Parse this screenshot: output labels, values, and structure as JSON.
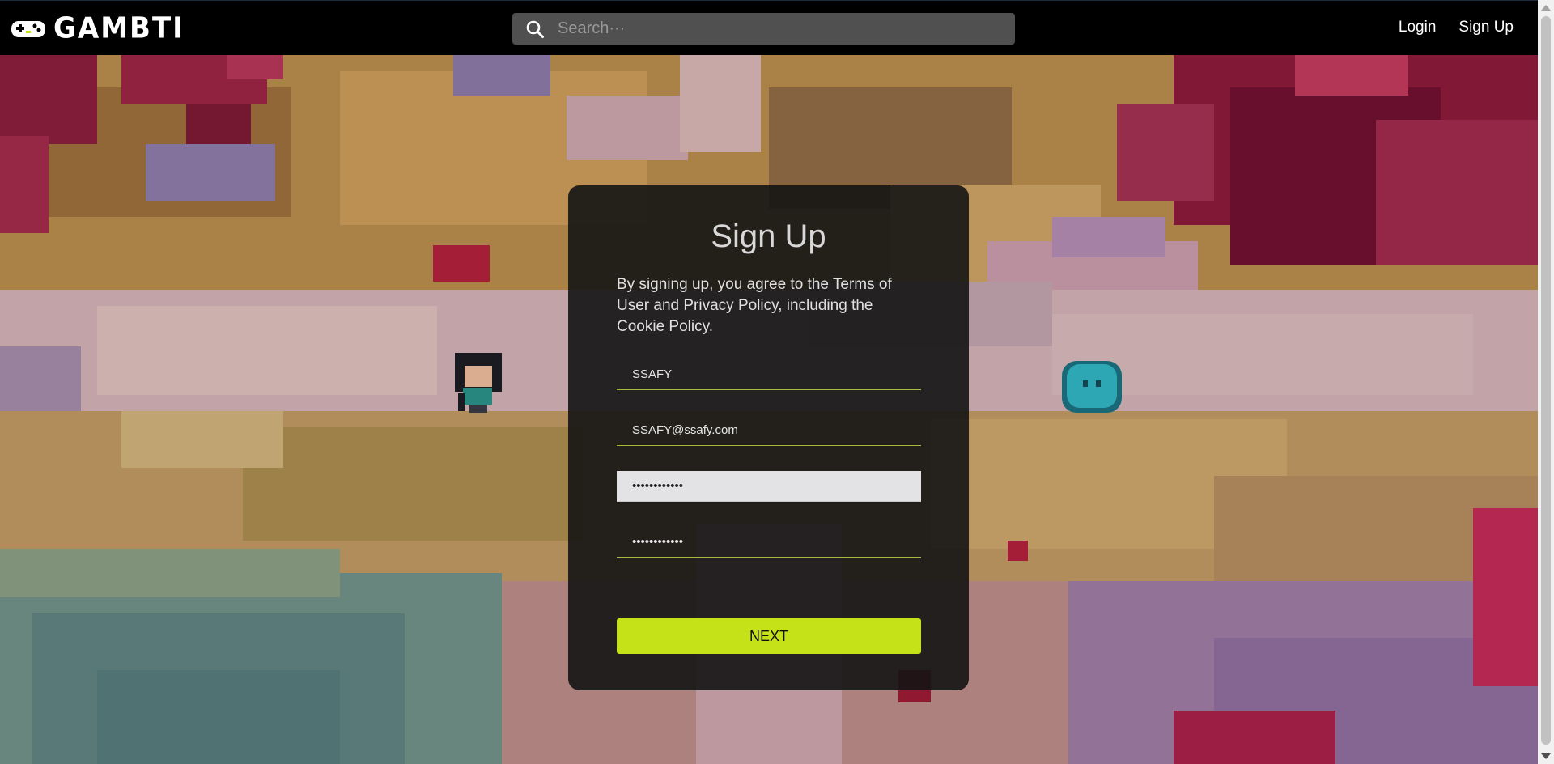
{
  "navbar": {
    "logo_text": "GAMBTI",
    "search_placeholder": "Search···",
    "login_label": "Login",
    "signup_label": "Sign Up"
  },
  "signup_card": {
    "title": "Sign Up",
    "terms_text": "By signing up, you agree to the Terms of User and Privacy Policy, including the Cookie Policy.",
    "username_value": "SSAFY",
    "email_value": "SSAFY@ssafy.com",
    "password_value": "ssafyssafy12",
    "password_confirm_value": "ssafyssafy12",
    "next_label": "NEXT"
  },
  "colors": {
    "accent": "#c5e118",
    "navbar_bg": "#000000",
    "search_bg": "#505050",
    "card_bg": "#141414",
    "underline": "#a8b83a"
  }
}
